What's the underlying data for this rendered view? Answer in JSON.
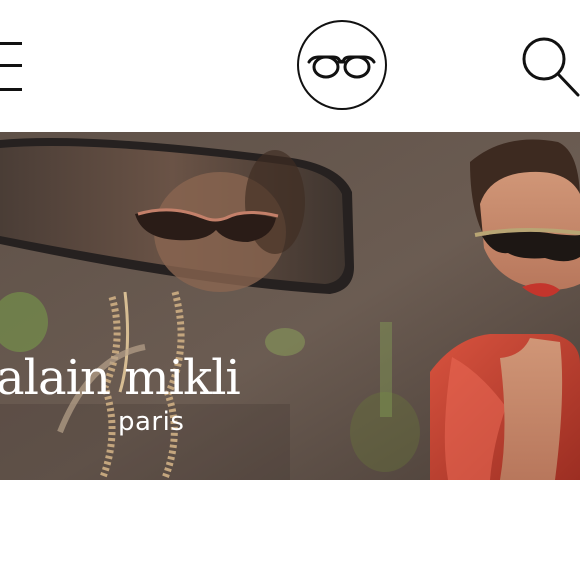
{
  "header": {
    "menu_icon": "hamburger-menu-icon",
    "logo_icon": "eyeglasses-icon",
    "search_icon": "search-icon"
  },
  "hero": {
    "brand_name": "alain mikli",
    "brand_city": "paris",
    "colors": {
      "background": "#5b4f48",
      "text": "#ffffff",
      "accent_red": "#c4352c"
    }
  }
}
